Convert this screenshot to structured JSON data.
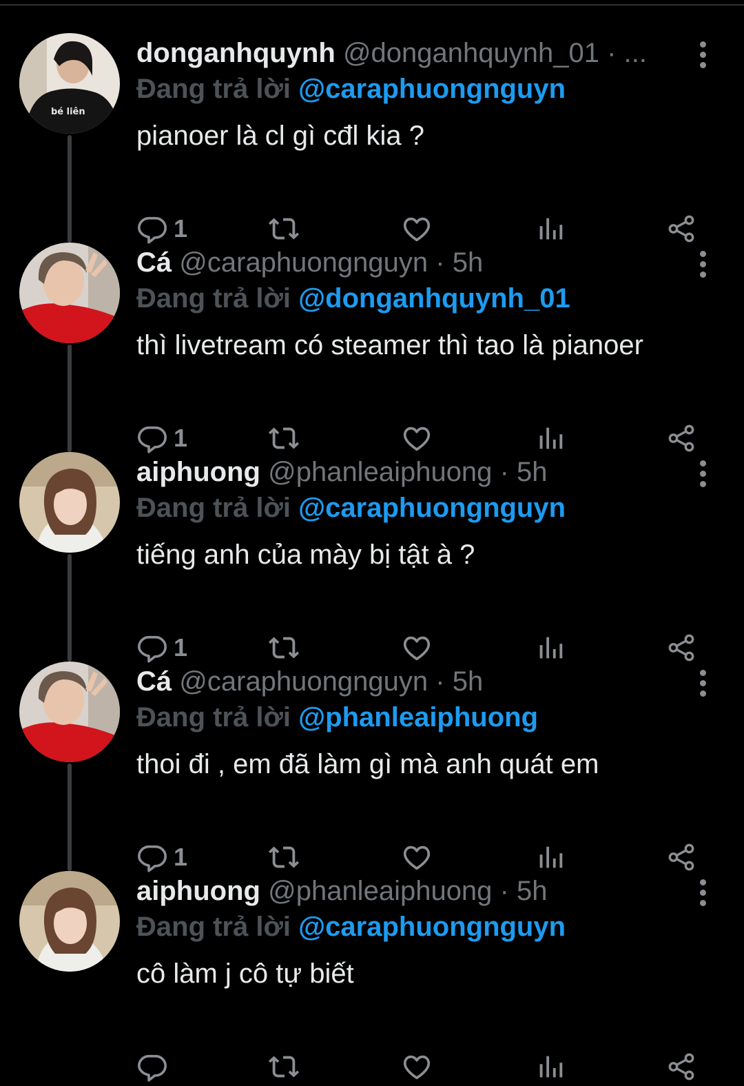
{
  "colors": {
    "background": "#000000",
    "text_primary": "#e7e9ea",
    "text_secondary": "#71767b",
    "link": "#1d9bf0",
    "thread_line": "#3a3d40",
    "reply_prefix": "#4d5257"
  },
  "tweets": [
    {
      "display_name": "donganhquynh",
      "handle": "@donganhquynh_01",
      "separator": "·",
      "time": "...",
      "reply_prefix": "Đang trả lời",
      "reply_to": "@caraphuongnguyn",
      "text": "pianoer là cl gì cđl kia ?",
      "reply_count": "1",
      "avatar_icon": "avatar-donganhquynh"
    },
    {
      "display_name": "Cá",
      "handle": "@caraphuongnguyn",
      "separator": "·",
      "time": "5h",
      "reply_prefix": "Đang trả lời",
      "reply_to": "@donganhquynh_01",
      "text": "thì livetream có steamer thì tao là pianoer",
      "reply_count": "1",
      "avatar_icon": "avatar-ca"
    },
    {
      "display_name": "aiphuong",
      "handle": "@phanleaiphuong",
      "separator": "·",
      "time": "5h",
      "reply_prefix": "Đang trả lời",
      "reply_to": "@caraphuongnguyn",
      "text": "tiếng anh của mày bị tật à ?",
      "reply_count": "1",
      "avatar_icon": "avatar-aiphuong"
    },
    {
      "display_name": "Cá",
      "handle": "@caraphuongnguyn",
      "separator": "·",
      "time": "5h",
      "reply_prefix": "Đang trả lời",
      "reply_to": "@phanleaiphuong",
      "text": "thoi đi , em đã làm gì mà anh quát em",
      "reply_count": "1",
      "avatar_icon": "avatar-ca"
    },
    {
      "display_name": "aiphuong",
      "handle": "@phanleaiphuong",
      "separator": "·",
      "time": "5h",
      "reply_prefix": "Đang trả lời",
      "reply_to": "@caraphuongnguyn",
      "text": "cô làm j cô tự biết",
      "reply_count": "",
      "avatar_icon": "avatar-aiphuong"
    }
  ],
  "avatar_shirt_text": "bé liên",
  "icons": {
    "reply": "reply-icon",
    "retweet": "retweet-icon",
    "like": "heart-icon",
    "views": "views-icon",
    "share": "share-icon",
    "more": "more-vertical-icon"
  }
}
